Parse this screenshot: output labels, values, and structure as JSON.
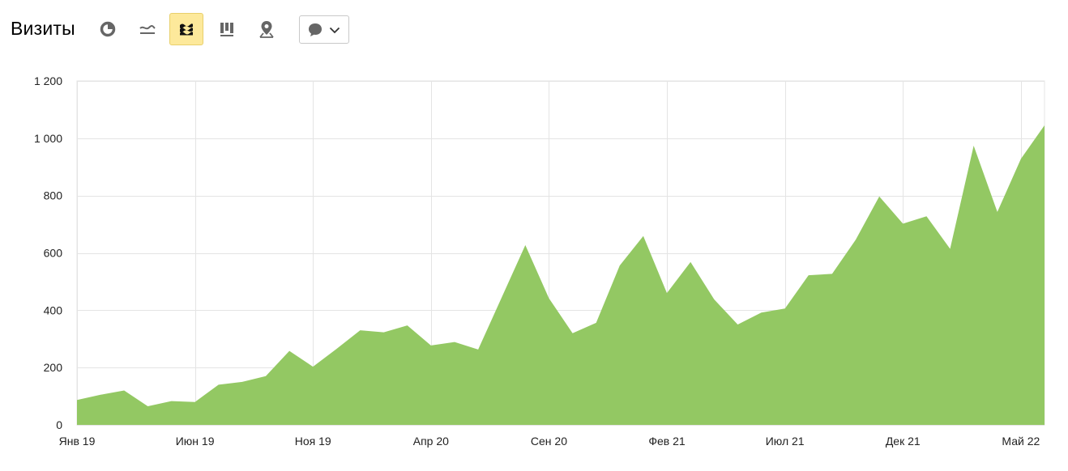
{
  "header": {
    "title": "Визиты",
    "tools": [
      {
        "name": "pie-chart-icon"
      },
      {
        "name": "line-chart-icon"
      },
      {
        "name": "area-chart-icon",
        "active": true
      },
      {
        "name": "bar-chart-icon"
      },
      {
        "name": "map-icon"
      }
    ],
    "annotation_dropdown": {
      "icon": "comment-icon",
      "chevron": "chevron-down-icon"
    }
  },
  "colors": {
    "area_fill": "#93c863",
    "active_tool_bg": "#fde99b",
    "grid": "#e4e4e4",
    "icon": "#666666"
  },
  "chart_data": {
    "type": "area",
    "title": "",
    "xlabel": "",
    "ylabel": "",
    "ylim": [
      0,
      1200
    ],
    "yticks": [
      0,
      200,
      400,
      600,
      800,
      1000,
      1200
    ],
    "ytick_labels": [
      "0",
      "200",
      "400",
      "600",
      "800",
      "1 000",
      "1 200"
    ],
    "xtick_labels": [
      "Янв 19",
      "Июн 19",
      "Ноя 19",
      "Апр 20",
      "Сен 20",
      "Фев 21",
      "Июл 21",
      "Дек 21",
      "Май 22"
    ],
    "xtick_index": [
      0,
      5,
      10,
      15,
      20,
      25,
      30,
      35,
      40
    ],
    "grid": true,
    "x": [
      "Янв 19",
      "Фев 19",
      "Мар 19",
      "Апр 19",
      "Май 19",
      "Июн 19",
      "Июл 19",
      "Авг 19",
      "Сен 19",
      "Окт 19",
      "Ноя 19",
      "Дек 19",
      "Янв 20",
      "Фев 20",
      "Мар 20",
      "Апр 20",
      "Май 20",
      "Июн 20",
      "Июл 20",
      "Авг 20",
      "Сен 20",
      "Окт 20",
      "Ноя 20",
      "Дек 20",
      "Янв 21",
      "Фев 21",
      "Мар 21",
      "Апр 21",
      "Май 21",
      "Июн 21",
      "Июл 21",
      "Авг 21",
      "Сен 21",
      "Окт 21",
      "Ноя 21",
      "Дек 21",
      "Янв 22",
      "Фев 22",
      "Мар 22",
      "Апр 22",
      "Май 22",
      "Июн 22"
    ],
    "series": [
      {
        "values": [
          87,
          105,
          120,
          65,
          83,
          80,
          140,
          150,
          170,
          258,
          203,
          265,
          330,
          323,
          347,
          277,
          289,
          263,
          445,
          627,
          442,
          320,
          356,
          556,
          659,
          460,
          568,
          438,
          350,
          392,
          406,
          522,
          527,
          646,
          797,
          702,
          728,
          614,
          974,
          743,
          928,
          1045
        ]
      }
    ]
  }
}
